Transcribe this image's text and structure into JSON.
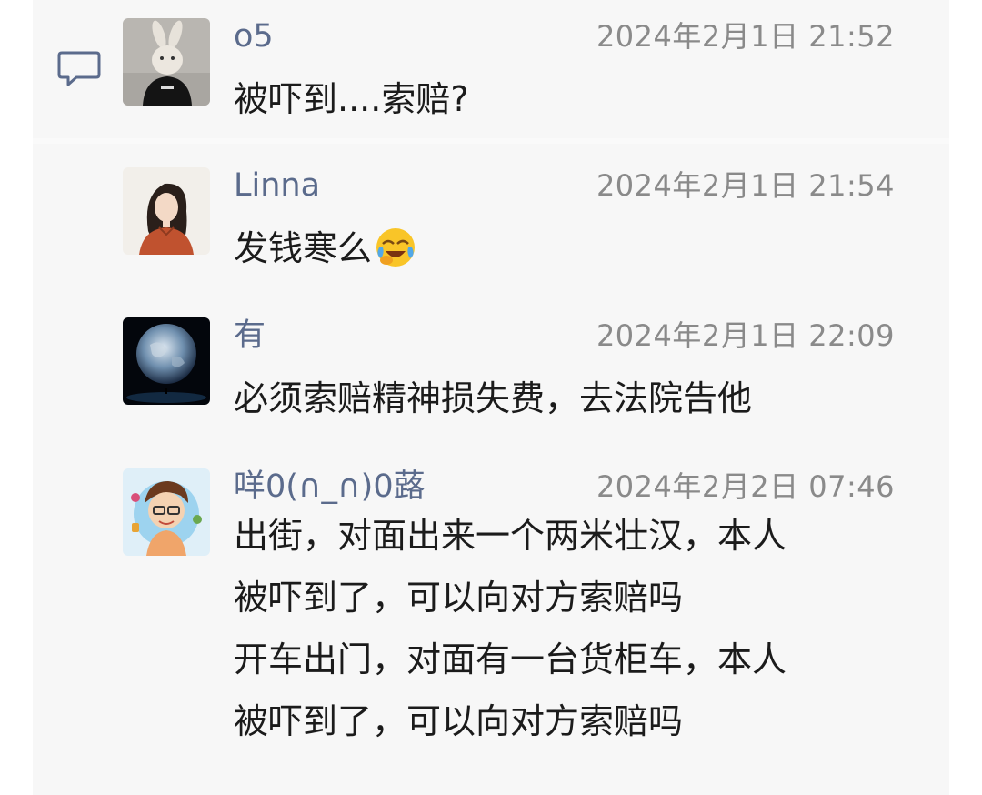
{
  "comments": [
    {
      "author": "o5",
      "time": "2024年2月1日 21:52",
      "text": "被吓到....索赔?"
    },
    {
      "author": "Linna",
      "time": "2024年2月1日 21:54",
      "text": "发钱寒么",
      "emoji": "laughing-crying-emoji"
    },
    {
      "author": "有",
      "time": "2024年2月1日 22:09",
      "text": "必须索赔精神损失费，去法院告他"
    },
    {
      "author": "咩0(∩_∩)0蕗",
      "time": "2024年2月2日 07:46",
      "lines": [
        "出街，对面出来一个两米壮汉，本人",
        "被吓到了，可以向对方索赔吗",
        "开车出门，对面有一台货柜车，本人",
        "被吓到了，可以向对方索赔吗"
      ]
    }
  ],
  "icons": {
    "comment": "comment-bubble-icon"
  },
  "colors": {
    "author": "#5b6b8c",
    "time": "#8a8a8a",
    "text": "#1b1b1b",
    "panel": "#f7f7f7"
  }
}
